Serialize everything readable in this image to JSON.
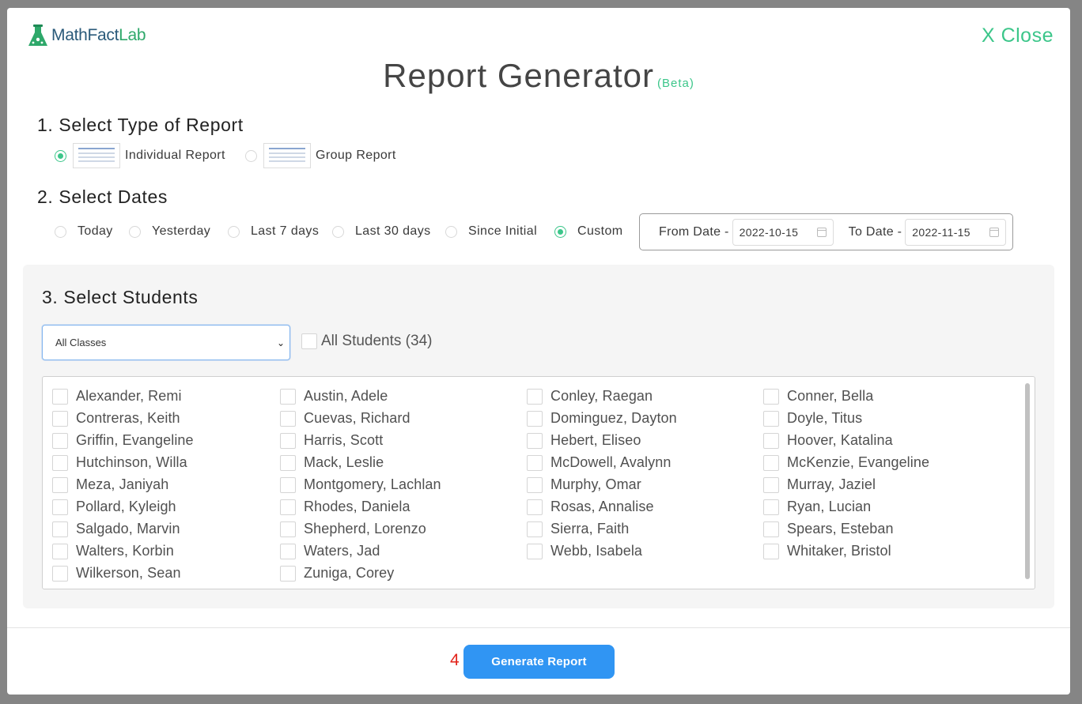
{
  "app": {
    "logo_part1": "MathFact",
    "logo_part2": "Lab",
    "close_label": "X Close"
  },
  "header": {
    "title": "Report Generator",
    "badge": "(Beta)"
  },
  "step1": {
    "heading": "1. Select Type of Report",
    "options": [
      {
        "label": "Individual Report",
        "selected": true
      },
      {
        "label": "Group Report",
        "selected": false
      }
    ]
  },
  "step2": {
    "heading": "2. Select Dates",
    "options": [
      {
        "label": "Today",
        "selected": false
      },
      {
        "label": "Yesterday",
        "selected": false
      },
      {
        "label": "Last 7 days",
        "selected": false
      },
      {
        "label": "Last 30 days",
        "selected": false
      },
      {
        "label": "Since Initial",
        "selected": false
      },
      {
        "label": "Custom",
        "selected": true
      }
    ],
    "from_label": "From Date -",
    "from_value": "2022-10-15",
    "to_label": "To Date -",
    "to_value": "2022-11-15"
  },
  "step3": {
    "heading": "3. Select Students",
    "class_select": "All Classes",
    "all_students_label": "All Students (34)",
    "students": [
      [
        "Alexander, Remi",
        "Austin, Adele",
        "Conley, Raegan",
        "Conner, Bella"
      ],
      [
        "Contreras, Keith",
        "Cuevas, Richard",
        "Dominguez, Dayton",
        "Doyle, Titus"
      ],
      [
        "Griffin, Evangeline",
        "Harris, Scott",
        "Hebert, Eliseo",
        "Hoover, Katalina"
      ],
      [
        "Hutchinson, Willa",
        "Mack, Leslie",
        "McDowell, Avalynn",
        "McKenzie, Evangeline"
      ],
      [
        "Meza, Janiyah",
        "Montgomery, Lachlan",
        "Murphy, Omar",
        "Murray, Jaziel"
      ],
      [
        "Pollard, Kyleigh",
        "Rhodes, Daniela",
        "Rosas, Annalise",
        "Ryan, Lucian"
      ],
      [
        "Salgado, Marvin",
        "Shepherd, Lorenzo",
        "Sierra, Faith",
        "Spears, Esteban"
      ],
      [
        "Walters, Korbin",
        "Waters, Jad",
        "Webb, Isabela",
        "Whitaker, Bristol"
      ],
      [
        "Wilkerson, Sean",
        "Zuniga, Corey"
      ]
    ]
  },
  "step4": {
    "marker": "4",
    "button_label": "Generate Report"
  },
  "colors": {
    "accent_green": "#3cc68a",
    "primary_blue": "#3095f3",
    "step_red": "#e2231a"
  }
}
